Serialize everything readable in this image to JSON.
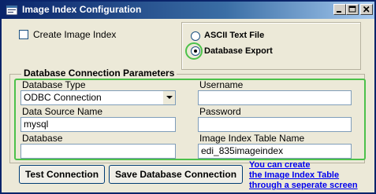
{
  "window": {
    "title": "Image Index Configuration"
  },
  "options": {
    "create_image_index": {
      "label": "Create Image Index",
      "checked": false
    },
    "export_format": {
      "options": [
        {
          "label": "ASCII Text File",
          "selected": false
        },
        {
          "label": "Database Export",
          "selected": true
        }
      ]
    }
  },
  "connection": {
    "group_title": "Database Connection Parameters",
    "database_type": {
      "label": "Database Type",
      "value": "ODBC Connection"
    },
    "username": {
      "label": "Username",
      "value": ""
    },
    "data_source_name": {
      "label": "Data Source Name",
      "value": "mysql"
    },
    "password": {
      "label": "Password",
      "value": ""
    },
    "database": {
      "label": "Database",
      "value": ""
    },
    "image_index_table_name": {
      "label": "Image Index Table Name",
      "value": "edi_835imageindex"
    }
  },
  "buttons": {
    "test_connection": "Test Connection",
    "save_connection": "Save Database Connection"
  },
  "help_link": {
    "line1": "You can create",
    "line2": "the Image Index Table",
    "line3": "through a seperate screen"
  },
  "colors": {
    "highlight_annotation": "#4cc14a",
    "title_bar": "#0a246a",
    "window_background": "#ece9d8",
    "link": "#0000ee"
  },
  "icons": [
    "app-window-icon",
    "minimize-icon",
    "maximize-icon",
    "close-icon",
    "dropdown-arrow-icon"
  ]
}
